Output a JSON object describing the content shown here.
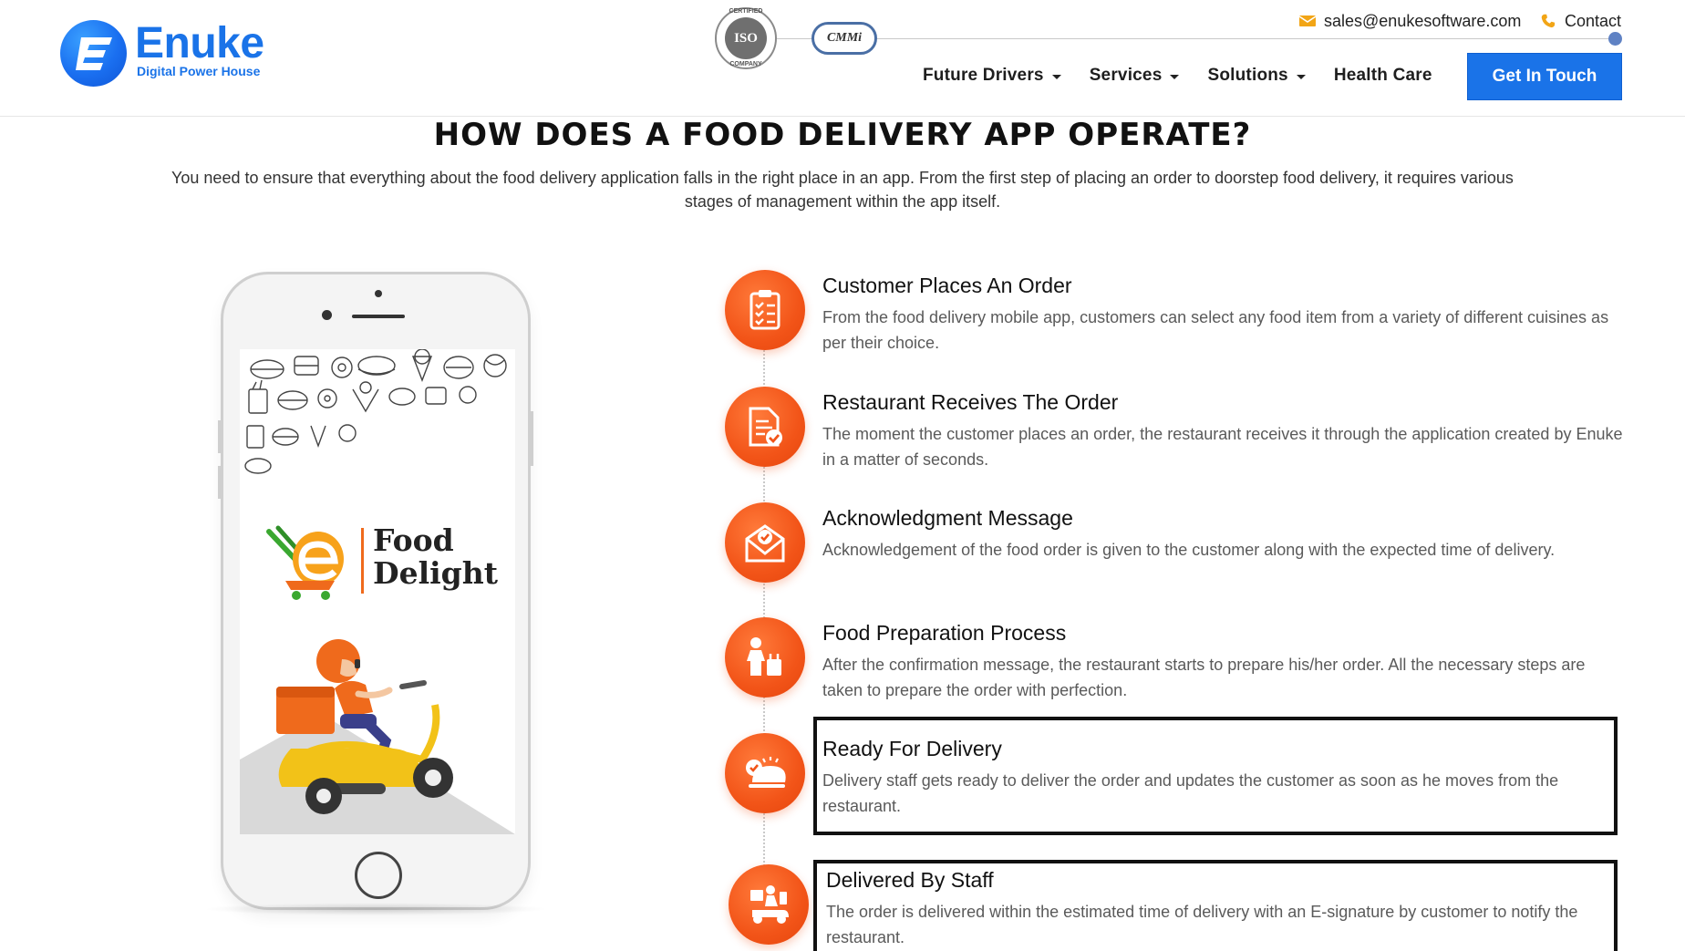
{
  "header": {
    "logo": {
      "name": "Enuke",
      "tagline": "Digital Power House"
    },
    "badges": {
      "iso_text": "ISO",
      "iso_ring_top": "CERTIFIED",
      "iso_ring_bottom": "COMPANY",
      "cmmi_text": "CMMi"
    },
    "email": "sales@enukesoftware.com",
    "contact_label": "Contact",
    "nav": [
      {
        "label": "Future Drivers",
        "has_dropdown": true
      },
      {
        "label": "Services",
        "has_dropdown": true
      },
      {
        "label": "Solutions",
        "has_dropdown": true
      },
      {
        "label": "Health Care",
        "has_dropdown": false
      }
    ],
    "cta_label": "Get In Touch"
  },
  "section": {
    "title": "HOW DOES A FOOD DELIVERY APP OPERATE?",
    "intro": "You need to ensure that everything about the food delivery application falls in the right place in an app. From the first step of placing an order to doorstep food delivery, it requires various stages of management within the app itself."
  },
  "phone": {
    "brand_line1": "Food",
    "brand_line2": "Delight"
  },
  "steps": [
    {
      "title": "Customer Places An Order",
      "description": "From the food delivery mobile app, customers can select any food item from a variety of different cuisines as per their choice.",
      "icon": "clipboard-checklist-icon"
    },
    {
      "title": "Restaurant Receives The Order",
      "description": "The moment the customer places an order, the restaurant receives it through the application created by Enuke in a matter of seconds.",
      "icon": "document-check-icon"
    },
    {
      "title": "Acknowledgment Message",
      "description": "Acknowledgement of the food order is given to the customer along with the expected time of delivery.",
      "icon": "envelope-check-icon"
    },
    {
      "title": "Food Preparation Process",
      "description": "After the confirmation message, the restaurant starts to prepare his/her order. All the necessary steps are taken to prepare the order with perfection.",
      "icon": "chef-icon"
    },
    {
      "title": "Ready For Delivery",
      "description": "Delivery staff gets ready to deliver the order and updates the customer as soon as he moves from the restaurant.",
      "icon": "food-cloche-check-icon"
    },
    {
      "title": "Delivered By Staff",
      "description": "The order is delivered within the estimated time of delivery with an E-signature by customer to notify the restaurant.",
      "icon": "delivery-scooter-icon"
    }
  ],
  "colors": {
    "brand_blue": "#1a73e8",
    "step_orange": "#f25418",
    "frame_black": "#111111"
  }
}
